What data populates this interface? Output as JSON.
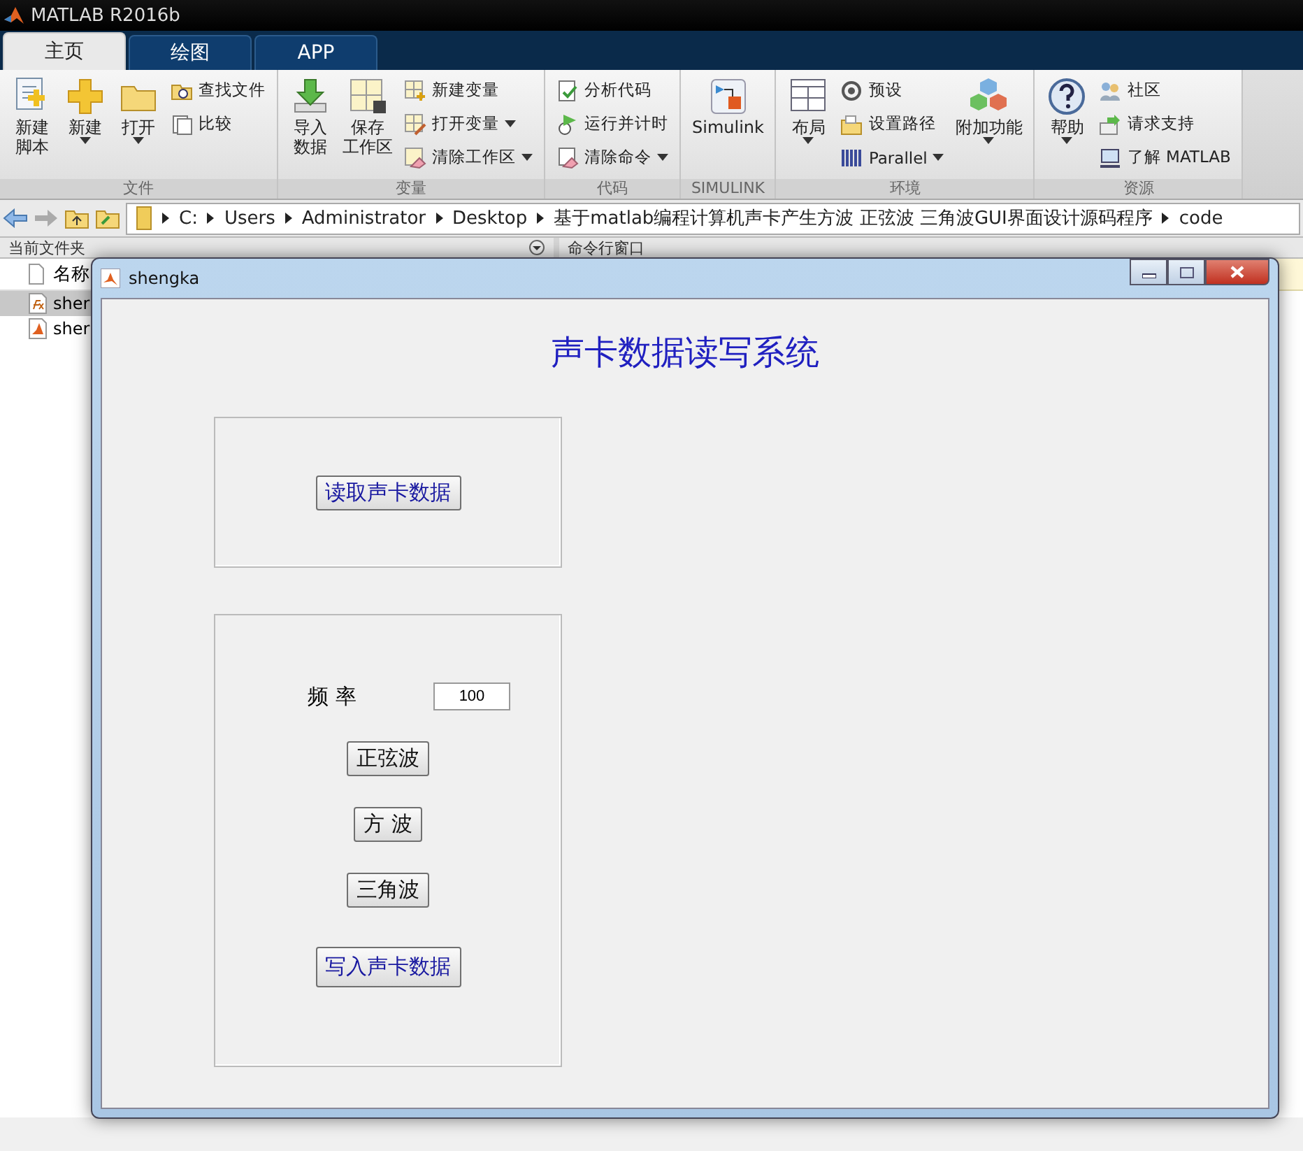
{
  "app_title": "MATLAB R2016b",
  "tabs": [
    {
      "label": "主页",
      "selected": true
    },
    {
      "label": "绘图",
      "selected": false
    },
    {
      "label": "APP",
      "selected": false
    }
  ],
  "ribbon_groups": [
    {
      "label": "文件",
      "tools": [
        {
          "kind": "large",
          "lines": [
            "新建",
            "脚本"
          ],
          "menu": false
        },
        {
          "kind": "large",
          "label": "新建",
          "menu": true
        },
        {
          "kind": "large",
          "label": "打开",
          "menu": true
        },
        {
          "kind": "small",
          "label": "查找文件",
          "menu": false
        },
        {
          "kind": "small",
          "label": "比较",
          "menu": false
        }
      ]
    },
    {
      "label": "变量",
      "tools": [
        {
          "kind": "large",
          "lines": [
            "导入",
            "数据"
          ],
          "menu": false
        },
        {
          "kind": "large",
          "lines": [
            "保存",
            "工作区"
          ],
          "menu": false
        },
        {
          "kind": "small",
          "label": "新建变量",
          "menu": false
        },
        {
          "kind": "small",
          "label": "打开变量",
          "menu": true
        },
        {
          "kind": "small",
          "label": "清除工作区",
          "menu": true
        }
      ]
    },
    {
      "label": "代码",
      "tools": [
        {
          "kind": "small",
          "label": "分析代码",
          "menu": false
        },
        {
          "kind": "small",
          "label": "运行并计时",
          "menu": false
        },
        {
          "kind": "small",
          "label": "清除命令",
          "menu": true
        }
      ]
    },
    {
      "label": "SIMULINK",
      "tools": [
        {
          "kind": "large",
          "label": "Simulink",
          "menu": false
        }
      ]
    },
    {
      "label": "环境",
      "tools": [
        {
          "kind": "large",
          "label": "布局",
          "menu": true
        },
        {
          "kind": "small",
          "label": "预设",
          "menu": false
        },
        {
          "kind": "small",
          "label": "设置路径",
          "menu": false
        },
        {
          "kind": "small",
          "label": "Parallel",
          "menu": true
        },
        {
          "kind": "large",
          "label": "附加功能",
          "menu": true
        }
      ]
    },
    {
      "label": "资源",
      "tools": [
        {
          "kind": "large",
          "label": "帮助",
          "menu": true
        },
        {
          "kind": "small",
          "label": "社区",
          "menu": false
        },
        {
          "kind": "small",
          "label": "请求支持",
          "menu": false
        },
        {
          "kind": "small",
          "label": "了解 MATLAB",
          "menu": false
        }
      ]
    }
  ],
  "address_path": [
    "C:",
    "Users",
    "Administrator",
    "Desktop",
    "基于matlab编程计算机声卡产生方波 正弦波 三角波GUI界面设计源码程序",
    "code"
  ],
  "file_panel": {
    "title": "当前文件夹",
    "column": "名称",
    "files": [
      {
        "name": "sher",
        "selected": true
      },
      {
        "name": "sher",
        "selected": false
      }
    ]
  },
  "command_panel": {
    "title": "命令行窗口"
  },
  "dialog": {
    "title": "shengka",
    "heading": "声卡数据读写系统",
    "read_button": "读取声卡数据",
    "freq_label": "频 率",
    "freq_value": "100",
    "wave_buttons": [
      "正弦波",
      "方 波",
      "三角波"
    ],
    "write_button": "写入声卡数据"
  }
}
